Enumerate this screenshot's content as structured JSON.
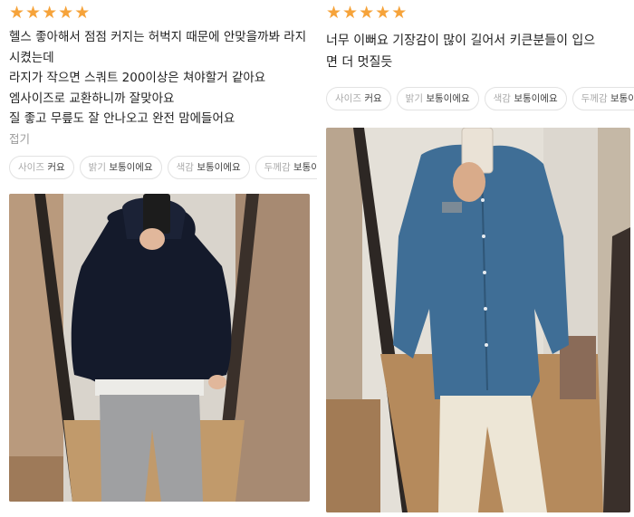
{
  "reviews": [
    {
      "rating": 5,
      "text": "헬스 좋아해서 점점 커지는 허벅지 때문에 안맞을까봐 라지\n시켰는데\n라지가 작으면 스쿼트 200이상은 쳐야할거 같아요\n엠사이즈로 교환하니까 잘맞아요\n질 좋고 무릎도 잘 안나오고 완전 맘에들어요",
      "fold_label": "접기",
      "attributes": [
        {
          "key": "사이즈",
          "value": "커요"
        },
        {
          "key": "밝기",
          "value": "보통이에요"
        },
        {
          "key": "색감",
          "value": "보통이에요"
        },
        {
          "key": "두께감",
          "value": "보통이에요"
        }
      ],
      "photo": {
        "description_icon": "photo-navy-hoodie-grey-pants"
      }
    },
    {
      "rating": 5,
      "text": "너무 이뻐요 기장감이 많이 길어서 키큰분들이 입으\n면 더 멋질듯",
      "attributes": [
        {
          "key": "사이즈",
          "value": "커요"
        },
        {
          "key": "밝기",
          "value": "보통이에요"
        },
        {
          "key": "색감",
          "value": "보통이에요"
        },
        {
          "key": "두께감",
          "value": "보통이에요"
        }
      ],
      "photo": {
        "description_icon": "photo-blue-shirt-cream-pants"
      }
    }
  ],
  "colors": {
    "star": "#f6a33a",
    "chip_border": "#e2e2e2",
    "muted_text": "#9a9a9a"
  }
}
